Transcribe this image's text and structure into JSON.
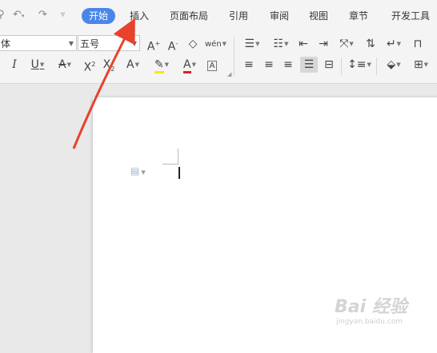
{
  "quick_access": {
    "icons": [
      "format-painter-icon",
      "undo-icon",
      "redo-icon",
      "customize-dropdown-icon"
    ]
  },
  "tabs": [
    {
      "label": "开始",
      "active": true
    },
    {
      "label": "插入",
      "active": false
    },
    {
      "label": "页面布局",
      "active": false
    },
    {
      "label": "引用",
      "active": false
    },
    {
      "label": "审阅",
      "active": false
    },
    {
      "label": "视图",
      "active": false
    },
    {
      "label": "章节",
      "active": false
    },
    {
      "label": "开发工具",
      "active": false
    }
  ],
  "font": {
    "family_value": "体",
    "size_value": "五号"
  },
  "buttons": {
    "grow": "A",
    "shrink": "A",
    "clear_format": "◇",
    "phonetic": "wén",
    "italic": "I",
    "underline": "U",
    "strike": "A",
    "superscript": "X",
    "subscript": "X",
    "text_effect": "A",
    "highlight": "✎",
    "font_color": "A",
    "char_border": "A"
  },
  "colors": {
    "active_tab": "#4a86e8",
    "arrow": "#e8412c",
    "highlight": "#ffe600",
    "font_color": "#e02020"
  },
  "watermark": {
    "text": "Bai 经验",
    "url": "jingyan.baidu.com"
  }
}
